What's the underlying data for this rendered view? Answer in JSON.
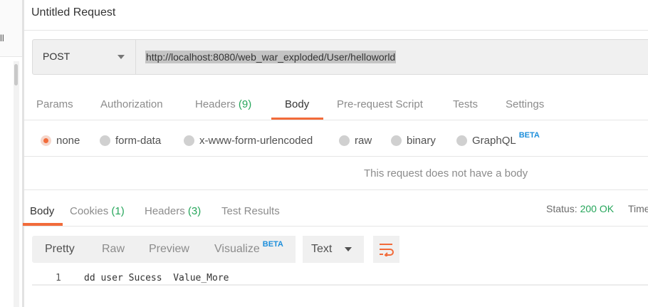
{
  "sidebar": {
    "cut_text": "ll"
  },
  "request": {
    "title": "Untitled Request",
    "method": "POST",
    "url": "http://localhost:8080/web_war_exploded/User/helloworld"
  },
  "request_tabs": [
    {
      "label": "Params",
      "count": ""
    },
    {
      "label": "Authorization",
      "count": ""
    },
    {
      "label": "Headers",
      "count": "(9)"
    },
    {
      "label": "Body",
      "count": "",
      "active": true
    },
    {
      "label": "Pre-request Script",
      "count": ""
    },
    {
      "label": "Tests",
      "count": ""
    },
    {
      "label": "Settings",
      "count": ""
    }
  ],
  "body_options": {
    "selected": "none",
    "items": [
      "none",
      "form-data",
      "x-www-form-urlencoded",
      "raw",
      "binary",
      "GraphQL"
    ],
    "graphql_badge": "BETA"
  },
  "no_body_message": "This request does not have a body",
  "response_tabs": [
    {
      "label": "Body",
      "count": "",
      "active": true
    },
    {
      "label": "Cookies",
      "count": "(1)"
    },
    {
      "label": "Headers",
      "count": "(3)"
    },
    {
      "label": "Test Results",
      "count": ""
    }
  ],
  "status": {
    "label": "Status:",
    "value": "200 OK",
    "time_label": "Time"
  },
  "view_modes": {
    "items": [
      "Pretty",
      "Raw",
      "Preview",
      "Visualize"
    ],
    "active": "Pretty",
    "visualize_badge": "BETA",
    "format": "Text"
  },
  "response_body": {
    "line_number": "1",
    "content": "dd user Sucess  Value_More"
  },
  "colors": {
    "accent": "#f26b3a",
    "success": "#26a65b",
    "beta": "#1e8fdb"
  },
  "icons": {
    "method_dropdown": "chevron-down-icon",
    "format_dropdown": "chevron-down-icon",
    "wrap": "wrap-lines-icon"
  }
}
